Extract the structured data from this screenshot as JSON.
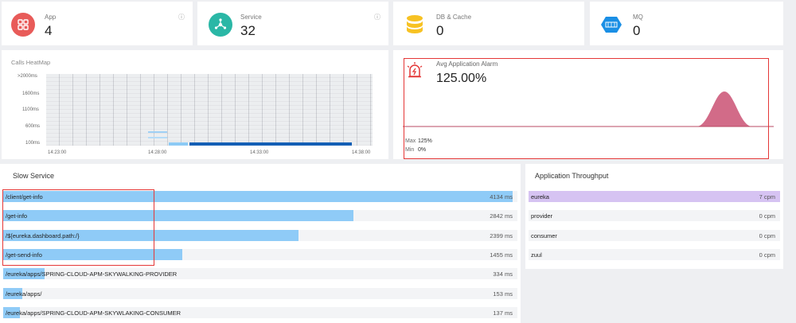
{
  "stats": [
    {
      "label": "App",
      "value": "4",
      "icon": "grid-icon",
      "color": "#e85b59"
    },
    {
      "label": "Service",
      "value": "32",
      "icon": "network-icon",
      "color": "#2ab7a6"
    },
    {
      "label": "DB & Cache",
      "value": "0",
      "icon": "database-icon",
      "color": "#f7c223"
    },
    {
      "label": "MQ",
      "value": "0",
      "icon": "queue-icon",
      "color": "#1a8fe5"
    }
  ],
  "info_glyph": "ⓘ",
  "heatmap": {
    "title": "Calls HeatMap",
    "y_ticks": [
      ">2000ms",
      "1600ms",
      "1100ms",
      "600ms",
      "100ms"
    ],
    "x_ticks": [
      "14:23:00",
      "14:28:00",
      "14:33:00",
      "14:38:00"
    ]
  },
  "alarm": {
    "title": "Avg Application Alarm",
    "value": "125.00%",
    "max_label": "Max",
    "max_value": "125%",
    "min_label": "Min",
    "min_value": "0%",
    "color": "#d06382"
  },
  "slow_service": {
    "title": "Slow Service",
    "max_ms": 4134,
    "items": [
      {
        "name": "/client/get-info",
        "value": "4134 ms",
        "ms": 4134
      },
      {
        "name": "/get-info",
        "value": "2842 ms",
        "ms": 2842
      },
      {
        "name": "/${eureka.dashboard.path:/}",
        "value": "2399 ms",
        "ms": 2399
      },
      {
        "name": "/get-send-info",
        "value": "1455 ms",
        "ms": 1455
      },
      {
        "name": "/eureka/apps/SPRING-CLOUD-APM-SKYWALKING-PROVIDER",
        "value": "334 ms",
        "ms": 334
      },
      {
        "name": "/eureka/apps/",
        "value": "153 ms",
        "ms": 153
      },
      {
        "name": "/eureka/apps/SPRING-CLOUD-APM-SKYWLAKING-CONSUMER",
        "value": "137 ms",
        "ms": 137
      }
    ]
  },
  "throughput": {
    "title": "Application Throughput",
    "items": [
      {
        "name": "eureka",
        "value": "7 cpm",
        "cpm": 7
      },
      {
        "name": "provider",
        "value": "0 cpm",
        "cpm": 0
      },
      {
        "name": "consumer",
        "value": "0 cpm",
        "cpm": 0
      },
      {
        "name": "zuul",
        "value": "0 cpm",
        "cpm": 0
      }
    ]
  }
}
